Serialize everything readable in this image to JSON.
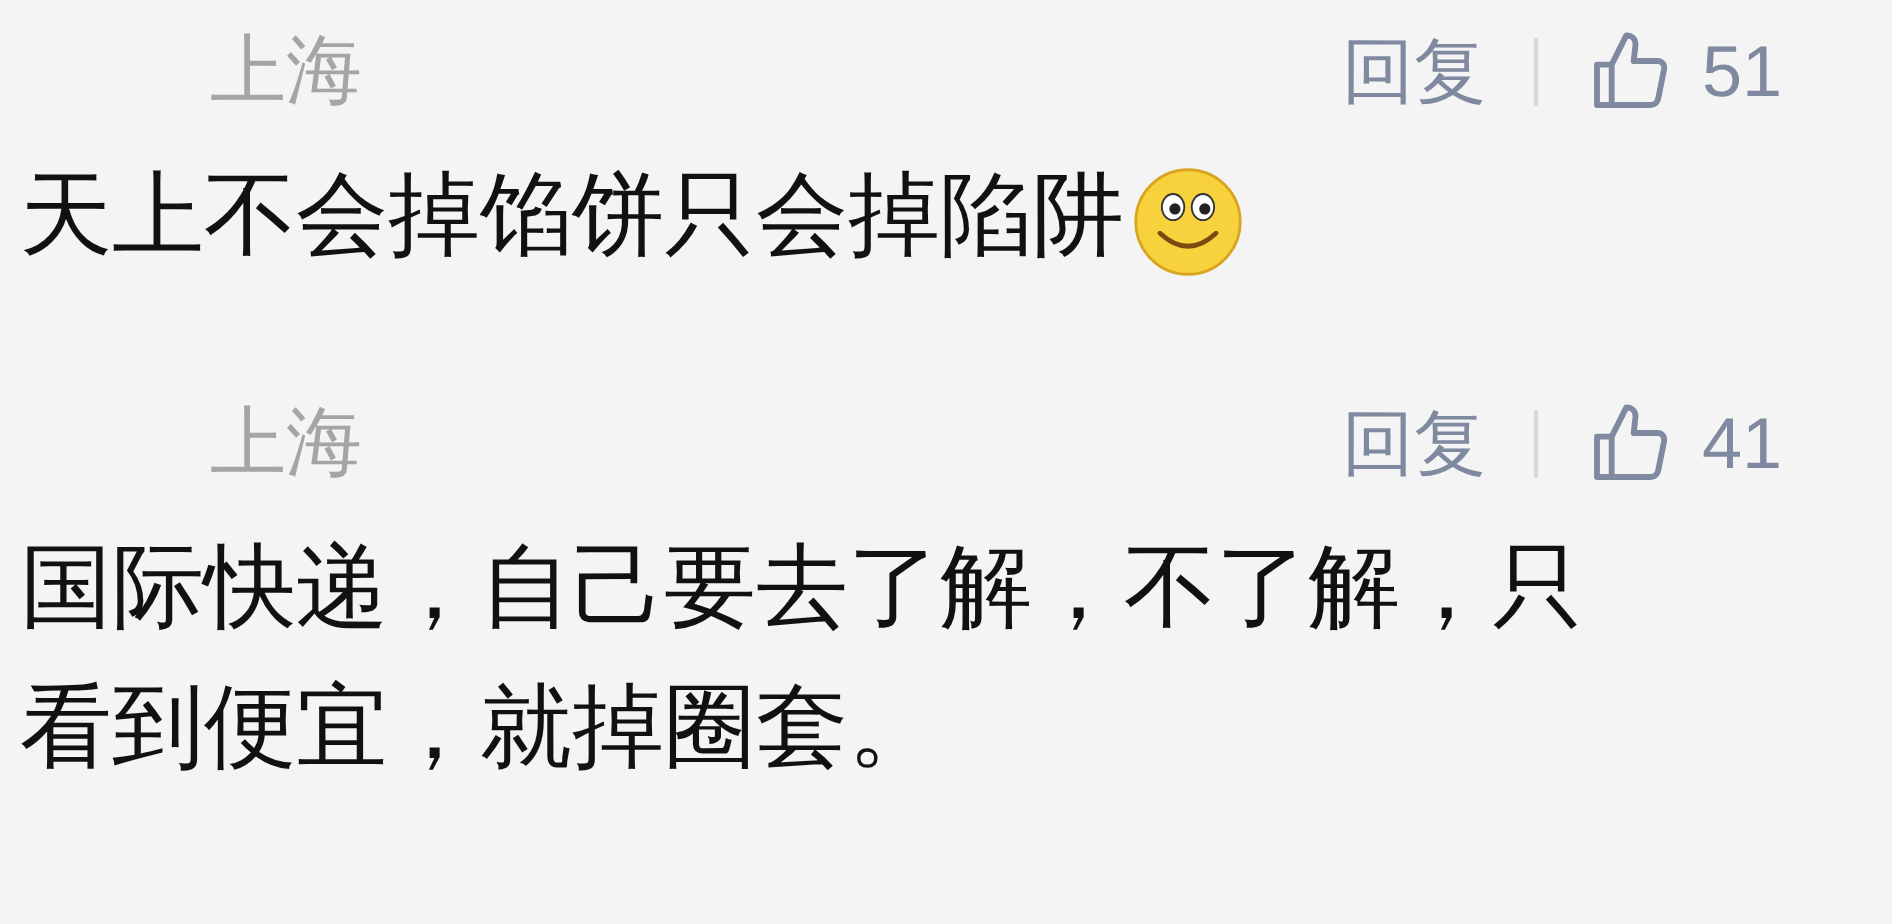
{
  "comments": [
    {
      "location": "上海",
      "reply": "回复",
      "likes": "51",
      "text": "天上不会掉馅饼只会掉陷阱",
      "emoji": true
    },
    {
      "location": "上海",
      "reply": "回复",
      "likes": "41",
      "text": "国际快递，自己要去了解，不了解，只看到便宜，就掉圈套。",
      "emoji": false
    }
  ]
}
